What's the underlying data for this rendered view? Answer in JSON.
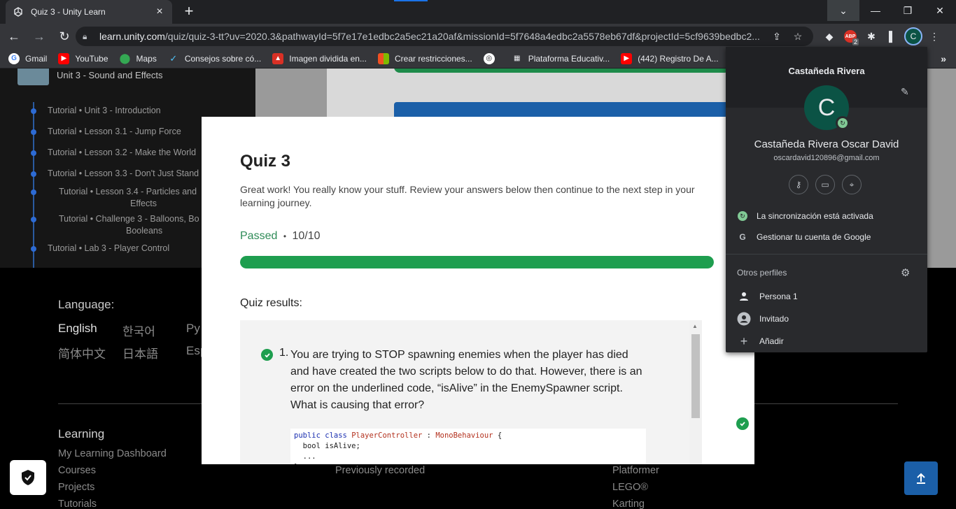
{
  "browser": {
    "tab": {
      "title": "Quiz 3 - Unity Learn"
    },
    "url": {
      "host": "learn.unity.com",
      "path": "/quiz/quiz-3-tt?uv=2020.3&pathwayId=5f7e17e1edbc2a5ec21a20af&missionId=5f7648a4edbc2a5578eb67df&projectId=5cf9639bedbc2..."
    },
    "abp_badge": "2",
    "abp_label": "ABP",
    "profile_initial": "C",
    "bookmarks": [
      {
        "label": "Gmail",
        "icon": "google-icon"
      },
      {
        "label": "YouTube",
        "icon": "youtube-icon"
      },
      {
        "label": "Maps",
        "icon": "maps-icon"
      },
      {
        "label": "Consejos sobre có...",
        "icon": "vm-icon"
      },
      {
        "label": "Imagen dividida en...",
        "icon": "image-icon"
      },
      {
        "label": "Crear restricciones...",
        "icon": "microsoft-icon"
      },
      {
        "label": "",
        "icon": "globe-icon"
      },
      {
        "label": "Plataforma Educativ...",
        "icon": "platform-icon"
      },
      {
        "label": "(442) Registro De A...",
        "icon": "youtube-icon"
      }
    ]
  },
  "course": {
    "unit_title": "Unit 3 - Sound and Effects",
    "items": [
      "Tutorial • Unit 3 - Introduction",
      "Tutorial • Lesson 3.1 - Jump Force",
      "Tutorial • Lesson 3.2 - Make the World",
      "Tutorial • Lesson 3.3 - Don't Just Stand",
      "Tutorial • Lesson 3.4 - Particles and",
      "Effects",
      "Tutorial • Challenge 3 - Balloons, Bo",
      "Booleans",
      "Tutorial • Lab 3 - Player Control"
    ]
  },
  "footer": {
    "language_title": "Language:",
    "languages": [
      "English",
      "한국어",
      "Ру",
      "简体中文",
      "日本語",
      "Esp"
    ],
    "learning_title": "Learning",
    "links_col1": [
      "My Learning Dashboard",
      "Courses",
      "Projects",
      "Tutorials"
    ],
    "links_col2": [
      "Previously recorded"
    ],
    "links_col3": [
      "Platformer",
      "LEGO®",
      "Karting"
    ]
  },
  "quiz": {
    "title": "Quiz 3",
    "description": "Great work! You really know your stuff. Review your answers below then continue to the next step in your learning journey.",
    "status": "Passed",
    "separator": "•",
    "score": "10/10",
    "progress": 1.0,
    "results_label": "Quiz results:",
    "question_number": "1.",
    "question_text": "You are trying to STOP spawning enemies when the player has died and have created the two scripts below to do that. However, there is an error on the underlined code, “isAlive” in the EnemySpawner script. What is causing that error?",
    "code": {
      "line1_kw": "public class",
      "line1_cls": "PlayerController",
      "line1_colon": " : ",
      "line1_base": "MonoBehaviour",
      "line1_brace": " {",
      "line2": "  bool isAlive;",
      "line3": "  ...",
      "line4": "}"
    }
  },
  "profile_popup": {
    "header_name": "Castañeda Rivera",
    "avatar_initial": "C",
    "full_name": "Castañeda Rivera Oscar David",
    "email": "oscardavid120896@gmail.com",
    "sync_label": "La sincronización está activada",
    "manage_label": "Gestionar tu cuenta de Google",
    "others_label": "Otros perfiles",
    "profiles": [
      {
        "label": "Persona 1",
        "icon": "person-icon"
      },
      {
        "label": "Invitado",
        "icon": "guest-icon"
      },
      {
        "label": "Añadir",
        "icon": "add-icon"
      }
    ]
  }
}
